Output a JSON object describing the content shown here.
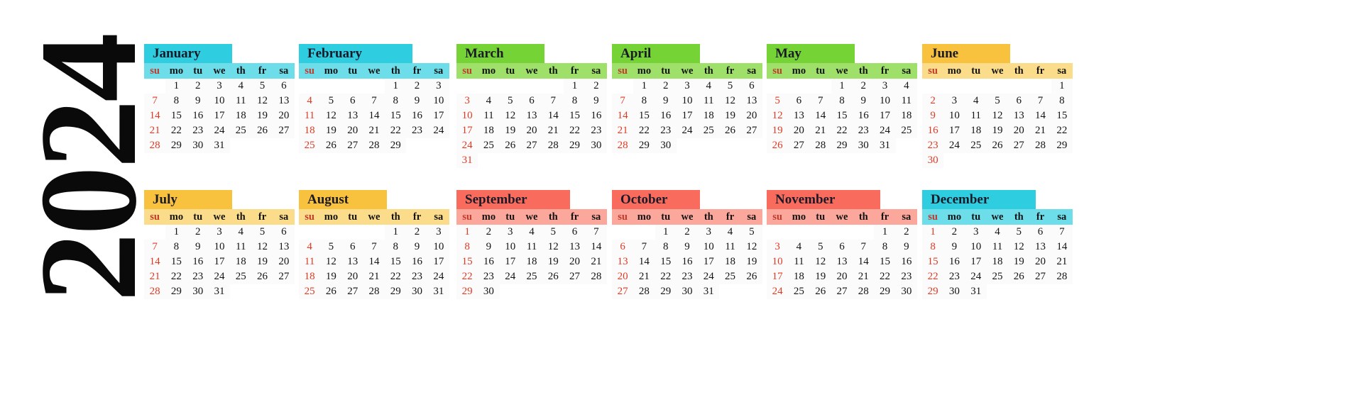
{
  "year": "2024",
  "weekdays": [
    "su",
    "mo",
    "tu",
    "we",
    "th",
    "fr",
    "sa"
  ],
  "colors": {
    "cyan_title": "#2ecde0",
    "cyan_week": "#6dddea",
    "green_title": "#76d335",
    "green_week": "#9fe06b",
    "amber_title": "#f8c13e",
    "amber_week": "#fbdc8a",
    "red_title": "#f96c5d",
    "red_week": "#fca79c",
    "sunday_text": "#e03a24",
    "day_text": "#141414",
    "background": "#ffffff"
  },
  "months": [
    {
      "name": "January",
      "theme": "cyan",
      "weeks": [
        [
          "",
          "1",
          "2",
          "3",
          "4",
          "5",
          "6"
        ],
        [
          "7",
          "8",
          "9",
          "10",
          "11",
          "12",
          "13"
        ],
        [
          "14",
          "15",
          "16",
          "17",
          "18",
          "19",
          "20"
        ],
        [
          "21",
          "22",
          "23",
          "24",
          "25",
          "26",
          "27"
        ],
        [
          "28",
          "29",
          "30",
          "31",
          "",
          "",
          ""
        ]
      ]
    },
    {
      "name": "February",
      "theme": "cyan",
      "weeks": [
        [
          "",
          "",
          "",
          "",
          "1",
          "2",
          "3"
        ],
        [
          "4",
          "5",
          "6",
          "7",
          "8",
          "9",
          "10"
        ],
        [
          "11",
          "12",
          "13",
          "14",
          "15",
          "16",
          "17"
        ],
        [
          "18",
          "19",
          "20",
          "21",
          "22",
          "23",
          "24"
        ],
        [
          "25",
          "26",
          "27",
          "28",
          "29",
          "",
          ""
        ]
      ]
    },
    {
      "name": "March",
      "theme": "green",
      "weeks": [
        [
          "",
          "",
          "",
          "",
          "",
          "1",
          "2"
        ],
        [
          "3",
          "4",
          "5",
          "6",
          "7",
          "8",
          "9"
        ],
        [
          "10",
          "11",
          "12",
          "13",
          "14",
          "15",
          "16"
        ],
        [
          "17",
          "18",
          "19",
          "20",
          "21",
          "22",
          "23"
        ],
        [
          "24",
          "25",
          "26",
          "27",
          "28",
          "29",
          "30"
        ],
        [
          "31",
          "",
          "",
          "",
          "",
          "",
          ""
        ]
      ]
    },
    {
      "name": "April",
      "theme": "green",
      "weeks": [
        [
          "",
          "1",
          "2",
          "3",
          "4",
          "5",
          "6"
        ],
        [
          "7",
          "8",
          "9",
          "10",
          "11",
          "12",
          "13"
        ],
        [
          "14",
          "15",
          "16",
          "17",
          "18",
          "19",
          "20"
        ],
        [
          "21",
          "22",
          "23",
          "24",
          "25",
          "26",
          "27"
        ],
        [
          "28",
          "29",
          "30",
          "",
          "",
          "",
          ""
        ]
      ]
    },
    {
      "name": "May",
      "theme": "green",
      "weeks": [
        [
          "",
          "",
          "",
          "1",
          "2",
          "3",
          "4"
        ],
        [
          "5",
          "6",
          "7",
          "8",
          "9",
          "10",
          "11"
        ],
        [
          "12",
          "13",
          "14",
          "15",
          "16",
          "17",
          "18"
        ],
        [
          "19",
          "20",
          "21",
          "22",
          "23",
          "24",
          "25"
        ],
        [
          "26",
          "27",
          "28",
          "29",
          "30",
          "31",
          ""
        ]
      ]
    },
    {
      "name": "June",
      "theme": "amber",
      "weeks": [
        [
          "",
          "",
          "",
          "",
          "",
          "",
          "1"
        ],
        [
          "2",
          "3",
          "4",
          "5",
          "6",
          "7",
          "8"
        ],
        [
          "9",
          "10",
          "11",
          "12",
          "13",
          "14",
          "15"
        ],
        [
          "16",
          "17",
          "18",
          "19",
          "20",
          "21",
          "22"
        ],
        [
          "23",
          "24",
          "25",
          "26",
          "27",
          "28",
          "29"
        ],
        [
          "30",
          "",
          "",
          "",
          "",
          "",
          ""
        ]
      ]
    },
    {
      "name": "July",
      "theme": "amber",
      "weeks": [
        [
          "",
          "1",
          "2",
          "3",
          "4",
          "5",
          "6"
        ],
        [
          "7",
          "8",
          "9",
          "10",
          "11",
          "12",
          "13"
        ],
        [
          "14",
          "15",
          "16",
          "17",
          "18",
          "19",
          "20"
        ],
        [
          "21",
          "22",
          "23",
          "24",
          "25",
          "26",
          "27"
        ],
        [
          "28",
          "29",
          "30",
          "31",
          "",
          "",
          ""
        ]
      ]
    },
    {
      "name": "August",
      "theme": "amber",
      "weeks": [
        [
          "",
          "",
          "",
          "",
          "1",
          "2",
          "3"
        ],
        [
          "4",
          "5",
          "6",
          "7",
          "8",
          "9",
          "10"
        ],
        [
          "11",
          "12",
          "13",
          "14",
          "15",
          "16",
          "17"
        ],
        [
          "18",
          "19",
          "20",
          "21",
          "22",
          "23",
          "24"
        ],
        [
          "25",
          "26",
          "27",
          "28",
          "29",
          "30",
          "31"
        ]
      ]
    },
    {
      "name": "September",
      "theme": "red",
      "weeks": [
        [
          "1",
          "2",
          "3",
          "4",
          "5",
          "6",
          "7"
        ],
        [
          "8",
          "9",
          "10",
          "11",
          "12",
          "13",
          "14"
        ],
        [
          "15",
          "16",
          "17",
          "18",
          "19",
          "20",
          "21"
        ],
        [
          "22",
          "23",
          "24",
          "25",
          "26",
          "27",
          "28"
        ],
        [
          "29",
          "30",
          "",
          "",
          "",
          "",
          ""
        ]
      ]
    },
    {
      "name": "October",
      "theme": "red",
      "weeks": [
        [
          "",
          "",
          "1",
          "2",
          "3",
          "4",
          "5"
        ],
        [
          "6",
          "7",
          "8",
          "9",
          "10",
          "11",
          "12"
        ],
        [
          "13",
          "14",
          "15",
          "16",
          "17",
          "18",
          "19"
        ],
        [
          "20",
          "21",
          "22",
          "23",
          "24",
          "25",
          "26"
        ],
        [
          "27",
          "28",
          "29",
          "30",
          "31",
          "",
          ""
        ]
      ]
    },
    {
      "name": "November",
      "theme": "red",
      "weeks": [
        [
          "",
          "",
          "",
          "",
          "",
          "1",
          "2"
        ],
        [
          "3",
          "4",
          "5",
          "6",
          "7",
          "8",
          "9"
        ],
        [
          "10",
          "11",
          "12",
          "13",
          "14",
          "15",
          "16"
        ],
        [
          "17",
          "18",
          "19",
          "20",
          "21",
          "22",
          "23"
        ],
        [
          "24",
          "25",
          "26",
          "27",
          "28",
          "29",
          "30"
        ]
      ]
    },
    {
      "name": "December",
      "theme": "cyan",
      "weeks": [
        [
          "1",
          "2",
          "3",
          "4",
          "5",
          "6",
          "7"
        ],
        [
          "8",
          "9",
          "10",
          "11",
          "12",
          "13",
          "14"
        ],
        [
          "15",
          "16",
          "17",
          "18",
          "19",
          "20",
          "21"
        ],
        [
          "22",
          "23",
          "24",
          "25",
          "26",
          "27",
          "28"
        ],
        [
          "29",
          "30",
          "31",
          "",
          "",
          "",
          ""
        ]
      ]
    }
  ]
}
